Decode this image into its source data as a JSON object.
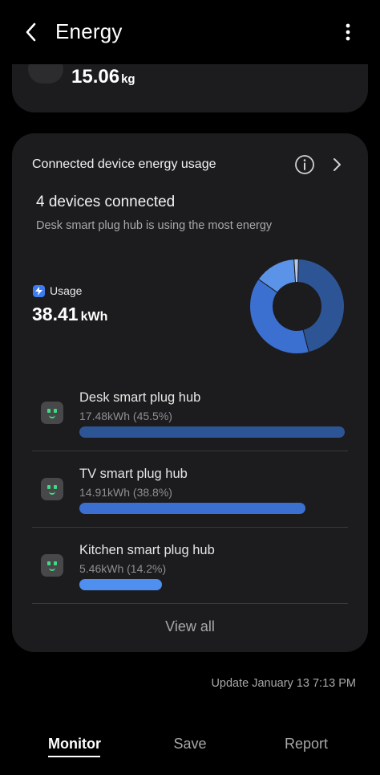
{
  "header": {
    "title": "Energy",
    "back_icon": "chevron-left-icon",
    "more_icon": "more-vertical-icon"
  },
  "top_card": {
    "value": "15.06",
    "unit": "kg",
    "icon": "leaf-icon",
    "icon_color": "#f5a623"
  },
  "card": {
    "title": "Connected device energy usage",
    "info_icon": "info-icon",
    "chevron_icon": "chevron-right-icon",
    "devices_connected": "4 devices connected",
    "subtitle": "Desk smart plug hub is using the most energy",
    "usage_label": "Usage",
    "usage_value": "38.41",
    "usage_unit": "kWh",
    "view_all": "View all"
  },
  "devices": [
    {
      "name": "Desk smart plug hub",
      "value": "17.48kWh (45.5%)",
      "share": 0.455,
      "color": "#2d5596"
    },
    {
      "name": "TV smart plug hub",
      "value": "14.91kWh (38.8%)",
      "share": 0.388,
      "color": "#3b6fd0"
    },
    {
      "name": "Kitchen smart plug hub",
      "value": "5.46kWh (14.2%)",
      "share": 0.142,
      "color": "#4f8ff0"
    }
  ],
  "donut": {
    "segments": [
      {
        "share": 0.455,
        "color": "#2d5596"
      },
      {
        "share": 0.388,
        "color": "#3b6fd0"
      },
      {
        "share": 0.142,
        "color": "#5b93e8"
      },
      {
        "share": 0.015,
        "color": "#b8c8e8"
      }
    ]
  },
  "footer": {
    "update_text": "Update January 13 7:13 PM"
  },
  "tabs": [
    {
      "label": "Monitor",
      "active": true
    },
    {
      "label": "Save",
      "active": false
    },
    {
      "label": "Report",
      "active": false
    }
  ]
}
